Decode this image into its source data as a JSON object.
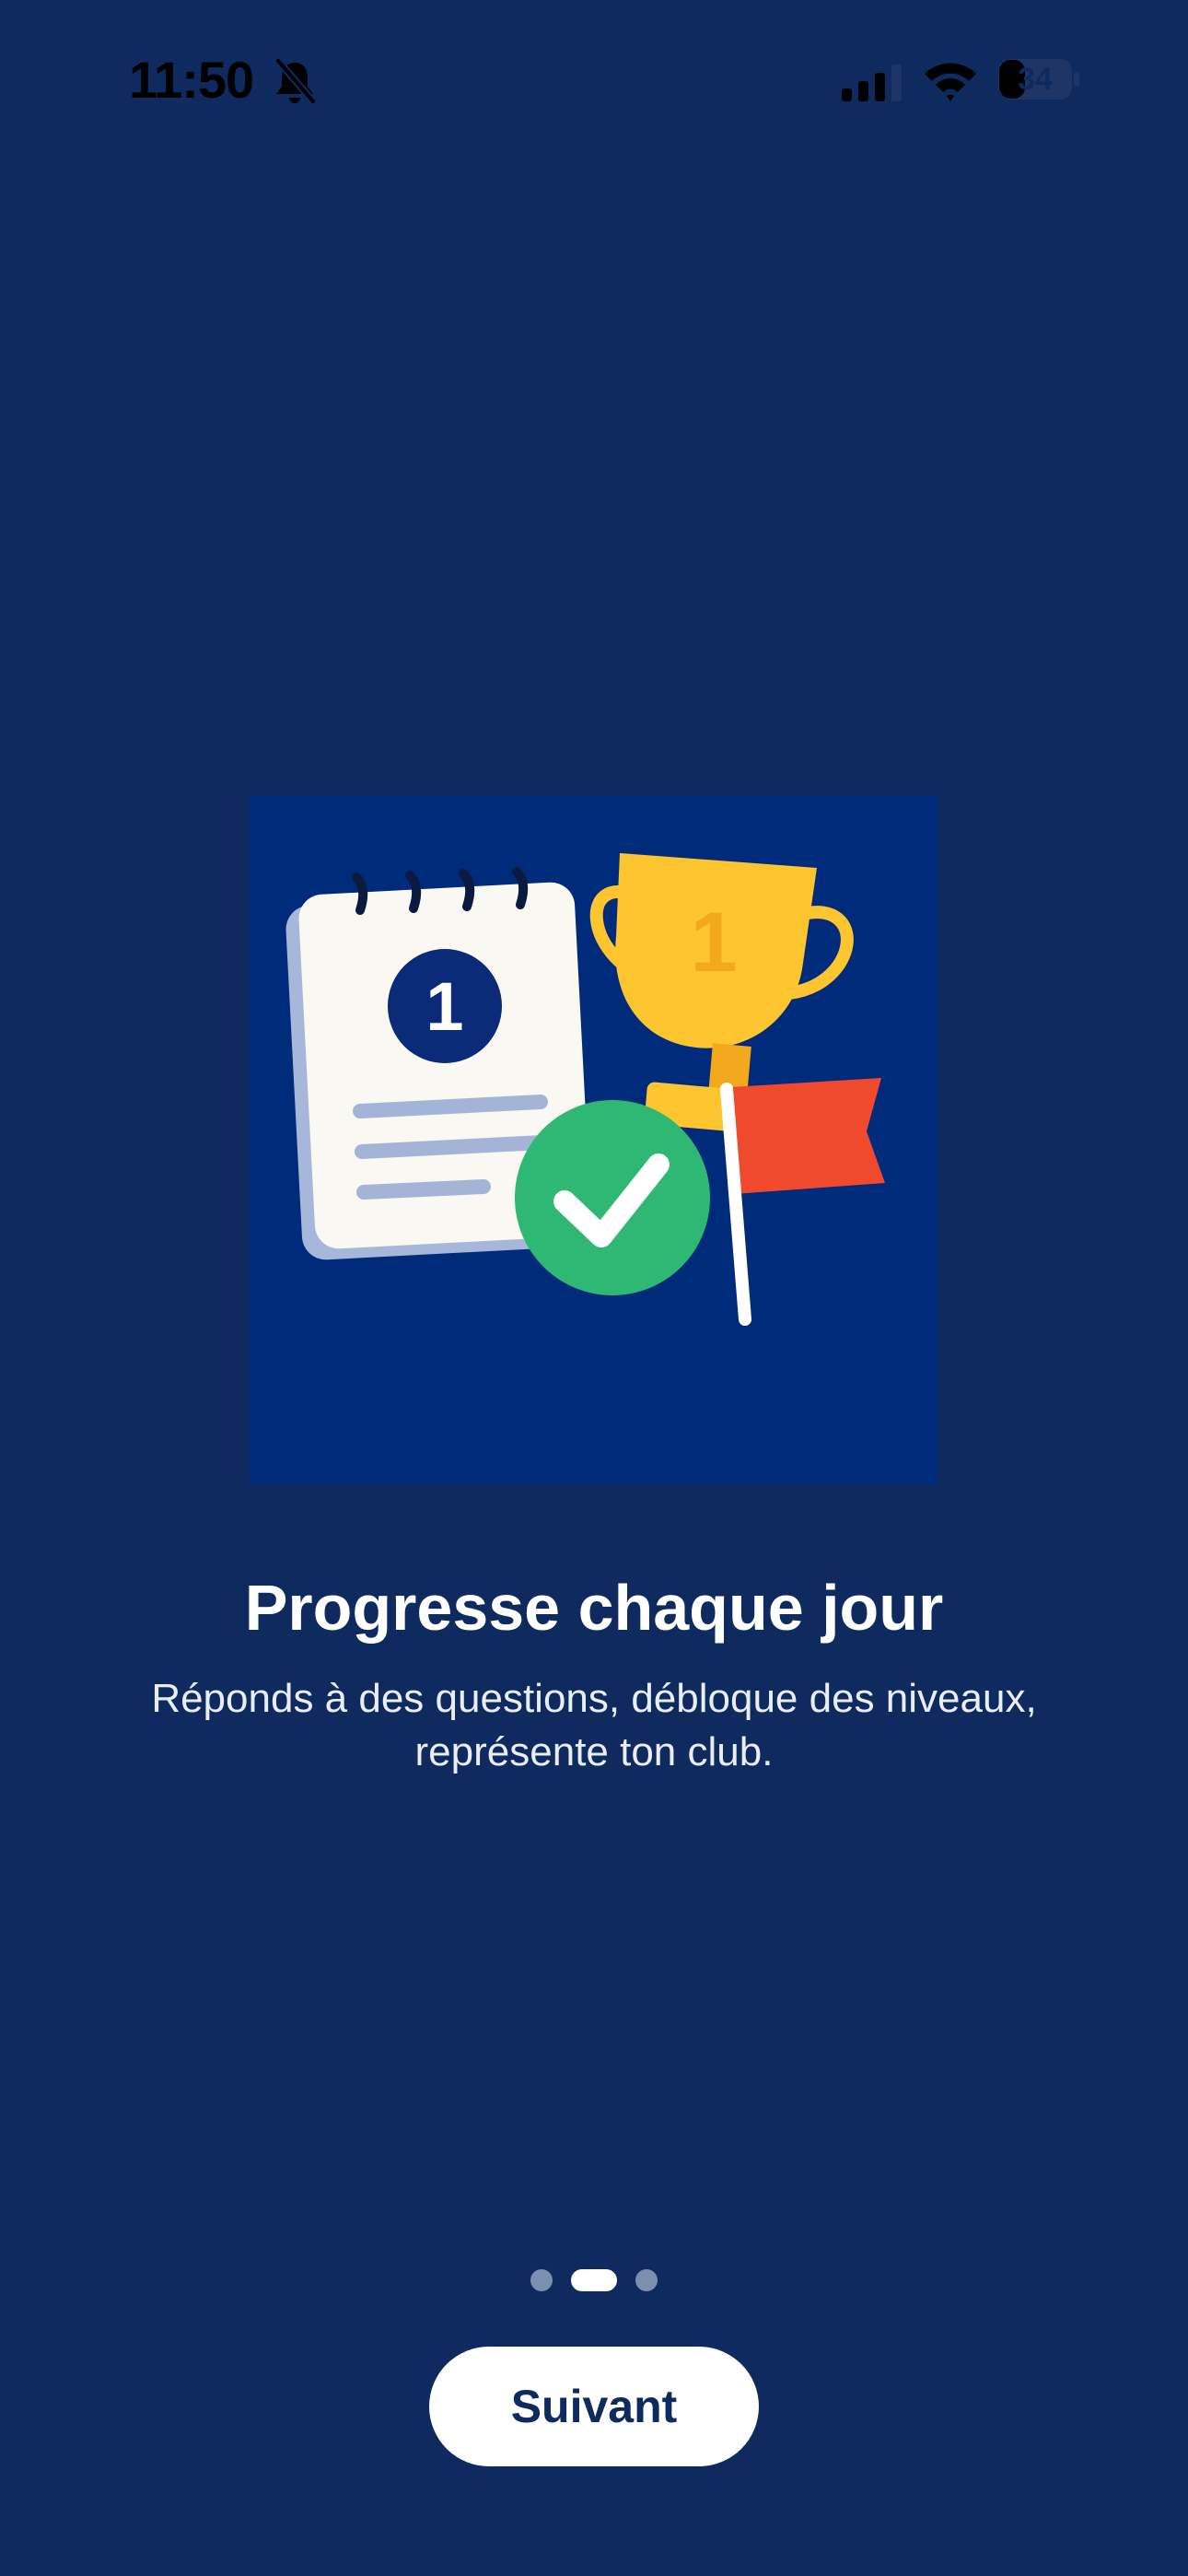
{
  "status_bar": {
    "time": "11:50",
    "battery": "34",
    "icons": [
      "bell-slash-icon",
      "cellular-signal-icon",
      "wifi-icon",
      "battery-icon"
    ]
  },
  "illustration": {
    "calendar_number": "1",
    "trophy_number": "1",
    "icons": [
      "calendar-icon",
      "trophy-icon",
      "checkmark-icon",
      "flag-icon"
    ]
  },
  "onboarding": {
    "title": "Progresse chaque jour",
    "subtitle": "Réponds à des questions, débloque des niveaux, représente ton club."
  },
  "pager": {
    "total": 3,
    "current": 2
  },
  "cta": {
    "label": "Suivant"
  },
  "colors": {
    "background": "#0e2a5e",
    "illustration_bg": "#002a7a",
    "trophy": "#fdc52f",
    "check_green": "#2eb873",
    "flag_red": "#f04a2e"
  }
}
